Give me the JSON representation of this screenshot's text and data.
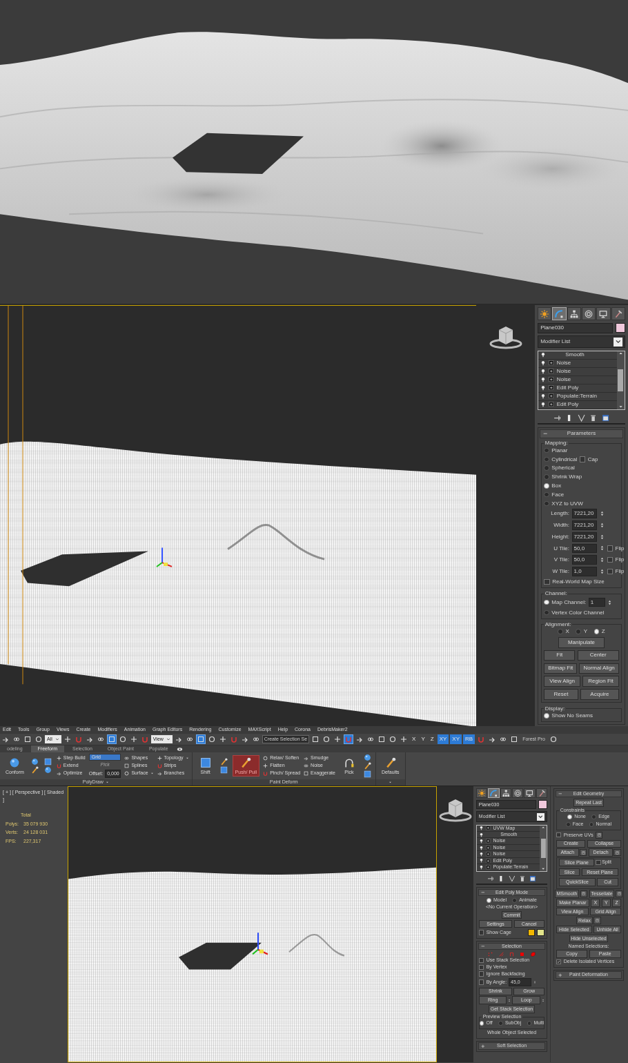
{
  "upper_panel": {
    "tabs": [
      {
        "selected": false
      },
      {
        "selected": true
      },
      {
        "selected": false
      },
      {
        "selected": false
      },
      {
        "selected": false
      },
      {
        "selected": false
      }
    ],
    "object_name": "Plane030",
    "modifier_list": "Modifier List",
    "stack": [
      {
        "label": "Smooth",
        "expandable": false
      },
      {
        "label": "Noise",
        "expandable": true
      },
      {
        "label": "Noise",
        "expandable": true
      },
      {
        "label": "Noise",
        "expandable": true
      },
      {
        "label": "Edit Poly",
        "expandable": true
      },
      {
        "label": "Populate:Terrain",
        "expandable": true
      },
      {
        "label": "Edit Poly",
        "expandable": true
      }
    ],
    "rollouts": [
      {
        "title": "Parameters",
        "expanded": true,
        "items": [
          {
            "kind": "group",
            "title": "Mapping:",
            "items": [
              {
                "kind": "radio",
                "label": "Planar",
                "selected": false
              },
              {
                "kind": "radio",
                "label": "Cylindrical",
                "selected": false,
                "check": {
                  "label": "Cap",
                  "checked": false
                }
              },
              {
                "kind": "radio",
                "label": "Spherical",
                "selected": false
              },
              {
                "kind": "radio",
                "label": "Shrink Wrap",
                "selected": false
              },
              {
                "kind": "radio",
                "label": "Box",
                "selected": true
              },
              {
                "kind": "radio",
                "label": "Face",
                "selected": false
              },
              {
                "kind": "radio",
                "label": "XYZ to UVW",
                "selected": false
              },
              {
                "kind": "spinner",
                "label": "Length:",
                "value": "7221,20"
              },
              {
                "kind": "spinner",
                "label": "Width:",
                "value": "7221,20"
              },
              {
                "kind": "spinner",
                "label": "Height:",
                "value": "7221,20"
              },
              {
                "kind": "spinner",
                "label": "U Tile:",
                "value": "50,0",
                "check": {
                  "label": "Flip",
                  "checked": false
                }
              },
              {
                "kind": "spinner",
                "label": "V Tile:",
                "value": "50,0",
                "check": {
                  "label": "Flip",
                  "checked": false
                }
              },
              {
                "kind": "spinner",
                "label": "W Tile:",
                "value": "1,0",
                "check": {
                  "label": "Flip",
                  "checked": false
                }
              },
              {
                "kind": "check",
                "label": "Real-World Map Size",
                "checked": false
              }
            ]
          },
          {
            "kind": "group",
            "title": "Channel:",
            "items": [
              {
                "kind": "radio",
                "label": "Map Channel:",
                "selected": true,
                "spinner": "1"
              },
              {
                "kind": "radio",
                "label": "Vertex Color Channel",
                "selected": false
              }
            ]
          },
          {
            "kind": "group",
            "title": "Alignment:",
            "items": [
              {
                "kind": "radio_row",
                "options": [
                  {
                    "label": "X",
                    "selected": false
                  },
                  {
                    "label": "Y",
                    "selected": false
                  },
                  {
                    "label": "Z",
                    "selected": true
                  }
                ]
              },
              {
                "kind": "buttons",
                "buttons": [
                  {
                    "label": "Manipulate"
                  }
                ]
              },
              {
                "kind": "buttons",
                "buttons": [
                  {
                    "label": "Fit"
                  },
                  {
                    "label": "Center"
                  }
                ]
              },
              {
                "kind": "buttons",
                "buttons": [
                  {
                    "label": "Bitmap Fit"
                  },
                  {
                    "label": "Normal Align"
                  }
                ]
              },
              {
                "kind": "buttons",
                "buttons": [
                  {
                    "label": "View Align"
                  },
                  {
                    "label": "Region Fit"
                  }
                ]
              },
              {
                "kind": "buttons",
                "buttons": [
                  {
                    "label": "Reset"
                  },
                  {
                    "label": "Acquire"
                  }
                ]
              }
            ]
          },
          {
            "kind": "group",
            "title": "Display:",
            "items": [
              {
                "kind": "radio",
                "label": "Show No Seams",
                "selected": true
              }
            ]
          }
        ]
      }
    ]
  },
  "menu": [
    "Edit",
    "Tools",
    "Group",
    "Views",
    "Create",
    "Modifiers",
    "Animation",
    "Graph Editors",
    "Rendering",
    "Customize",
    "MAXScript",
    "Help",
    "Corona",
    "DebrisMaker2"
  ],
  "toolbar": [
    {
      "kind": "icon",
      "selected": false
    },
    {
      "kind": "icon",
      "selected": false
    },
    {
      "kind": "icon",
      "selected": false
    },
    {
      "kind": "icon",
      "selected": false
    },
    {
      "kind": "dropdown",
      "label": "All",
      "selected": false
    },
    {
      "kind": "icon",
      "selected": false
    },
    {
      "kind": "icon",
      "selected": false
    },
    {
      "kind": "icon",
      "selected": false
    },
    {
      "kind": "icon",
      "selected": false
    },
    {
      "kind": "icon",
      "selected": true
    },
    {
      "kind": "icon",
      "selected": false
    },
    {
      "kind": "icon",
      "selected": false
    },
    {
      "kind": "icon",
      "selected": false
    },
    {
      "kind": "dropdown",
      "label": "View",
      "selected": false
    },
    {
      "kind": "icon",
      "selected": false
    },
    {
      "kind": "icon",
      "selected": false
    },
    {
      "kind": "icon",
      "selected": true
    },
    {
      "kind": "icon",
      "selected": false
    },
    {
      "kind": "icon",
      "selected": false
    },
    {
      "kind": "icon",
      "selected": false
    },
    {
      "kind": "icon",
      "selected": false
    },
    {
      "kind": "icon",
      "selected": false
    },
    {
      "kind": "field",
      "label": "Create Selection Se",
      "selected": false
    },
    {
      "kind": "icon",
      "selected": false
    },
    {
      "kind": "icon",
      "selected": false
    },
    {
      "kind": "icon",
      "selected": false
    },
    {
      "kind": "icon",
      "selected": true
    },
    {
      "kind": "icon",
      "selected": false
    },
    {
      "kind": "icon",
      "selected": false
    },
    {
      "kind": "icon",
      "selected": false
    },
    {
      "kind": "icon",
      "selected": false
    },
    {
      "kind": "icon",
      "selected": false
    },
    {
      "kind": "text",
      "label": "X",
      "selected": false
    },
    {
      "kind": "text",
      "label": "Y",
      "selected": false
    },
    {
      "kind": "text",
      "label": "Z",
      "selected": false
    },
    {
      "kind": "text",
      "label": "XY",
      "selected": true
    },
    {
      "kind": "text",
      "label": "XY",
      "selected": true
    },
    {
      "kind": "text",
      "label": "RB",
      "selected": true
    },
    {
      "kind": "icon",
      "selected": false
    },
    {
      "kind": "icon",
      "selected": false
    },
    {
      "kind": "icon",
      "selected": false
    },
    {
      "kind": "icon",
      "selected": false
    },
    {
      "kind": "text",
      "label": "Forest Pro",
      "selected": false
    },
    {
      "kind": "icon",
      "selected": false
    }
  ],
  "ribbon": {
    "tabs": [
      {
        "label": "odeling",
        "selected": false
      },
      {
        "label": "Freeform",
        "selected": true
      },
      {
        "label": "Selection",
        "selected": false
      },
      {
        "label": "Object Paint",
        "selected": false
      },
      {
        "label": "Populate",
        "selected": false
      }
    ],
    "panels": [
      {
        "label": "PolyDraw",
        "menu": true,
        "columns": [
          [
            {
              "kind": "big",
              "label": "Conform",
              "selected": false
            }
          ],
          [
            {
              "kind": "icon"
            },
            {
              "kind": "icon"
            }
          ],
          [
            {
              "kind": "icon"
            },
            {
              "kind": "icon"
            }
          ],
          [
            {
              "kind": "tool",
              "label": "Step Build",
              "menu": false
            },
            {
              "kind": "tool",
              "label": "Extend",
              "menu": false
            },
            {
              "kind": "tool",
              "label": "Optimize",
              "menu": false
            }
          ],
          [
            {
              "kind": "dropdown",
              "label": "Grid",
              "selected": true
            },
            {
              "kind": "text",
              "label": "Pick",
              "disabled": true
            },
            {
              "kind": "field",
              "label": "Offset:",
              "value": "0,000"
            }
          ],
          [
            {
              "kind": "tool",
              "label": "Shapes",
              "menu": false
            },
            {
              "kind": "tool",
              "label": "Splines",
              "menu": false
            },
            {
              "kind": "tool",
              "label": "Surface",
              "menu": true
            }
          ],
          [
            {
              "kind": "tool",
              "label": "Topology",
              "menu": true
            },
            {
              "kind": "tool",
              "label": "Strips",
              "menu": false
            },
            {
              "kind": "tool",
              "label": "Branches",
              "menu": false
            }
          ]
        ]
      },
      {
        "label": "Paint Deform",
        "menu": false,
        "columns": [
          [
            {
              "kind": "big",
              "label": "Shift",
              "selected": false
            }
          ],
          [
            {
              "kind": "icon"
            },
            {
              "kind": "icon"
            }
          ],
          [
            {
              "kind": "big",
              "label": "Push/ Pull",
              "selected": true
            }
          ],
          [
            {
              "kind": "tool",
              "label": "Relax/ Soften",
              "menu": false
            },
            {
              "kind": "tool",
              "label": "Flatten",
              "menu": false
            },
            {
              "kind": "tool",
              "label": "Pinch/ Spread",
              "menu": false
            }
          ],
          [
            {
              "kind": "tool",
              "label": "Smudge",
              "menu": false
            },
            {
              "kind": "tool",
              "label": "Noise",
              "menu": false
            },
            {
              "kind": "tool",
              "label": "Exaggerate",
              "menu": false
            }
          ],
          [
            {
              "kind": "big",
              "label": "Pick",
              "selected": false
            }
          ],
          [
            {
              "kind": "icon"
            },
            {
              "kind": "icon"
            },
            {
              "kind": "icon"
            }
          ]
        ]
      },
      {
        "menu": true,
        "columns": [
          [
            {
              "kind": "big",
              "label": "Defaults",
              "selected": false
            }
          ]
        ]
      }
    ]
  },
  "bottom_viewport": {
    "label": "[ + ] [ Perspective ] [ Shaded ]",
    "stats_heading": "Total",
    "stats": [
      {
        "label": "Polys:",
        "value": "35 079 930"
      },
      {
        "label": "Verts:",
        "value": "24 128 031"
      },
      {
        "label": "FPS:",
        "value": "227,317"
      }
    ]
  },
  "lower_panel": {
    "tabs": [
      {
        "selected": false
      },
      {
        "selected": true
      },
      {
        "selected": false
      },
      {
        "selected": false
      },
      {
        "selected": false
      },
      {
        "selected": false
      }
    ],
    "object_name": "Plane030",
    "modifier_list": "Modifier List",
    "stack": [
      {
        "label": "UVW Map",
        "expandable": true
      },
      {
        "label": "Smooth",
        "expandable": false
      },
      {
        "label": "Noise",
        "expandable": true
      },
      {
        "label": "Noise",
        "expandable": true
      },
      {
        "label": "Noise",
        "expandable": true
      },
      {
        "label": "Edit Poly",
        "expandable": true
      },
      {
        "label": "Populate:Terrain",
        "expandable": true
      }
    ],
    "rollouts": [
      {
        "title": "Edit Poly Mode",
        "expanded": true,
        "items": [
          {
            "kind": "radio_row",
            "options": [
              {
                "label": "Model",
                "selected": true
              },
              {
                "label": "Animate",
                "selected": false
              }
            ]
          },
          {
            "kind": "text",
            "text": "<No Current Operation>"
          },
          {
            "kind": "buttons",
            "buttons": [
              {
                "label": "Commit"
              }
            ]
          },
          {
            "kind": "buttons",
            "buttons": [
              {
                "label": "Settings"
              },
              {
                "label": "Cancel"
              }
            ]
          },
          {
            "kind": "check",
            "label": "Show Cage",
            "checked": false,
            "swatches": [
              {
                "color": "#f2b800"
              },
              {
                "color": "#e2e48a"
              }
            ]
          }
        ]
      },
      {
        "title": "Selection",
        "expanded": true,
        "items": [
          {
            "kind": "icons"
          },
          {
            "kind": "check",
            "label": "Use Stack Selection",
            "checked": false
          },
          {
            "kind": "check",
            "label": "By Vertex",
            "checked": false
          },
          {
            "kind": "check",
            "label": "Ignore Backfacing",
            "checked": false
          },
          {
            "kind": "check",
            "label": "By Angle:",
            "checked": false,
            "spinner": "45,0"
          },
          {
            "kind": "buttons",
            "buttons": [
              {
                "label": "Shrink"
              },
              {
                "label": "Grow"
              }
            ]
          },
          {
            "kind": "buttons",
            "buttons": [
              {
                "label": "Ring",
                "spinner": true
              },
              {
                "label": "Loop",
                "spinner": true
              }
            ]
          },
          {
            "kind": "buttons",
            "buttons": [
              {
                "label": "Get Stack Selection"
              }
            ]
          },
          {
            "kind": "group",
            "title": "Preview Selection",
            "items": [
              {
                "kind": "radio_row",
                "options": [
                  {
                    "label": "Off",
                    "selected": true
                  },
                  {
                    "label": "SubObj",
                    "selected": false
                  },
                  {
                    "label": "Multi",
                    "selected": false
                  }
                ]
              }
            ]
          },
          {
            "kind": "text",
            "text": "Whole Object Selected"
          }
        ]
      },
      {
        "title": "Soft Selection",
        "expanded": false
      }
    ]
  },
  "edit_geometry": {
    "rollouts": [
      {
        "title": "Edit Geometry",
        "expanded": true,
        "items": [
          {
            "kind": "buttons",
            "buttons": [
              {
                "label": "Repeat Last"
              }
            ]
          },
          {
            "kind": "group",
            "title": "Constraints",
            "items": [
              {
                "kind": "radio_row",
                "options": [
                  {
                    "label": "None",
                    "selected": true
                  },
                  {
                    "label": "Edge",
                    "selected": false
                  }
                ]
              },
              {
                "kind": "radio_row",
                "options": [
                  {
                    "label": "Face",
                    "selected": false
                  },
                  {
                    "label": "Normal",
                    "selected": false
                  }
                ]
              }
            ]
          },
          {
            "kind": "check",
            "label": "Preserve UVs",
            "checked": false,
            "settings": true
          },
          {
            "kind": "buttons",
            "buttons": [
              {
                "label": "Create"
              },
              {
                "label": "Collapse"
              }
            ]
          },
          {
            "kind": "buttons",
            "buttons": [
              {
                "label": "Attach",
                "settings": true
              },
              {
                "label": "Detach",
                "settings": true
              }
            ]
          },
          {
            "kind": "group",
            "items": [
              {
                "kind": "buttons",
                "buttons": [
                  {
                    "label": "Slice Plane"
                  },
                  {
                    "kind": "check",
                    "label": "Split",
                    "checked": false
                  }
                ]
              },
              {
                "kind": "buttons",
                "buttons": [
                  {
                    "label": "Slice"
                  },
                  {
                    "label": "Reset Plane"
                  }
                ]
              },
              {
                "kind": "buttons",
                "buttons": [
                  {
                    "label": "QuickSlice"
                  },
                  {
                    "label": "Cut"
                  }
                ]
              }
            ]
          },
          {
            "kind": "buttons",
            "buttons": [
              {
                "label": "MSmooth",
                "settings": true
              },
              {
                "label": "Tessellate",
                "settings": true
              }
            ]
          },
          {
            "kind": "buttons",
            "buttons": [
              {
                "label": "Make Planar"
              },
              {
                "label": "X"
              },
              {
                "label": "Y"
              },
              {
                "label": "Z"
              }
            ]
          },
          {
            "kind": "buttons",
            "buttons": [
              {
                "label": "View Align"
              },
              {
                "label": "Grid Align"
              }
            ]
          },
          {
            "kind": "buttons",
            "buttons": [
              {
                "label": "Relax",
                "settings": true
              }
            ]
          },
          {
            "kind": "buttons",
            "buttons": [
              {
                "label": "Hide Selected"
              },
              {
                "label": "Unhide All"
              }
            ]
          },
          {
            "kind": "buttons",
            "buttons": [
              {
                "label": "Hide Unselected"
              }
            ]
          },
          {
            "kind": "text",
            "text": "Named Selections:"
          },
          {
            "kind": "buttons",
            "buttons": [
              {
                "label": "Copy"
              },
              {
                "label": "Paste"
              }
            ]
          },
          {
            "kind": "check",
            "label": "Delete Isolated Vertices",
            "checked": true
          }
        ]
      },
      {
        "title": "Paint Deformation",
        "expanded": false
      }
    ]
  }
}
